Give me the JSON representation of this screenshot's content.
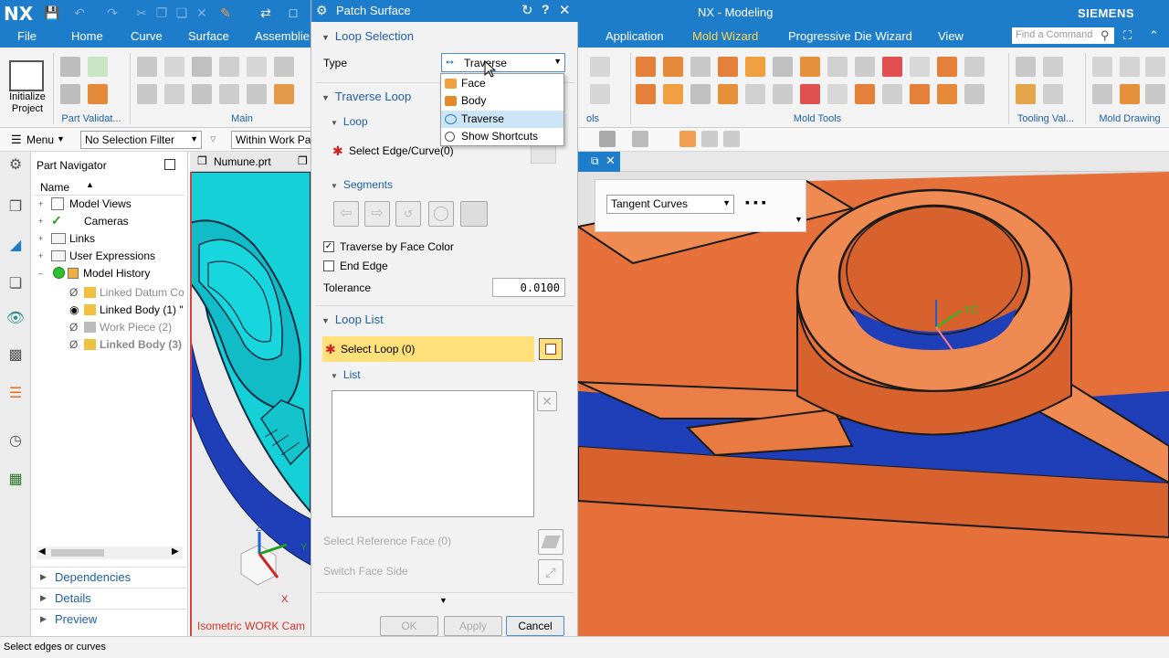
{
  "app": {
    "logo": "NX",
    "title": "NX - Modeling",
    "brand": "SIEMENS"
  },
  "tabs": [
    {
      "label": "File"
    },
    {
      "label": "Home"
    },
    {
      "label": "Curve"
    },
    {
      "label": "Surface"
    },
    {
      "label": "Assemblies"
    },
    {
      "label": "Application"
    },
    {
      "label": "Mold Wizard"
    },
    {
      "label": "Progressive Die Wizard"
    },
    {
      "label": "View"
    }
  ],
  "active_tab": "Mold Wizard",
  "find_command": {
    "placeholder": "Find a Command"
  },
  "ribbon": {
    "initialize_project": "Initialize Project",
    "groups": {
      "part_validation": "Part Validat...",
      "main": "Main",
      "tools": "ols",
      "mold_tools": "Mold Tools",
      "tooling_validation": "Tooling Val...",
      "mold_drawing": "Mold Drawing"
    }
  },
  "selection_bar": {
    "menu": "Menu",
    "filter": "No Selection Filter",
    "scope": "Within Work Part"
  },
  "part_navigator": {
    "title": "Part Navigator",
    "column_name": "Name",
    "items": [
      {
        "label": "Model Views"
      },
      {
        "label": "Cameras"
      },
      {
        "label": "Links"
      },
      {
        "label": "User Expressions"
      },
      {
        "label": "Model History"
      },
      {
        "label": "Linked Datum Co"
      },
      {
        "label": "Linked Body (1) \""
      },
      {
        "label": "Work Piece (2)"
      },
      {
        "label": "Linked Body (3)"
      }
    ],
    "sections": [
      {
        "label": "Dependencies"
      },
      {
        "label": "Details"
      },
      {
        "label": "Preview"
      }
    ]
  },
  "graphics": {
    "tab_left": "Numune.prt",
    "view_label": "Isometric WORK Cam",
    "curve_rule": "Tangent Curves",
    "axis_z": "Z",
    "axis_y": "Y",
    "axis_x": "X",
    "axis_yc": "YC"
  },
  "dialog": {
    "title": "Patch Surface",
    "loop_selection": "Loop Selection",
    "type_label": "Type",
    "type_value": "Traverse",
    "type_options": [
      {
        "label": "Face"
      },
      {
        "label": "Body"
      },
      {
        "label": "Traverse"
      },
      {
        "label": "Show Shortcuts"
      }
    ],
    "traverse_loop": "Traverse Loop",
    "loop": "Loop",
    "select_edge_curve": "Select Edge/Curve",
    "select_edge_count": "(0)",
    "segments": "Segments",
    "traverse_by_face_color": "Traverse by Face Color",
    "traverse_by_face_color_checked": true,
    "end_edge": "End Edge",
    "end_edge_checked": false,
    "tolerance_label": "Tolerance",
    "tolerance_value": "0.0100",
    "loop_list": "Loop List",
    "select_loop": "Select Loop (0)",
    "list": "List",
    "select_reference_face": "Select Reference Face (0)",
    "switch_face_side": "Switch Face Side",
    "ok": "OK",
    "apply": "Apply",
    "cancel": "Cancel"
  },
  "status": {
    "text": "Select edges or curves"
  },
  "colors": {
    "accent": "#1e7dcb",
    "active_tab": "#ffd54a",
    "model_orange": "#e5703a",
    "model_blue": "#1f3fb8",
    "model_cyan": "#16d0d8",
    "highlight_yellow": "#ffe07a"
  }
}
